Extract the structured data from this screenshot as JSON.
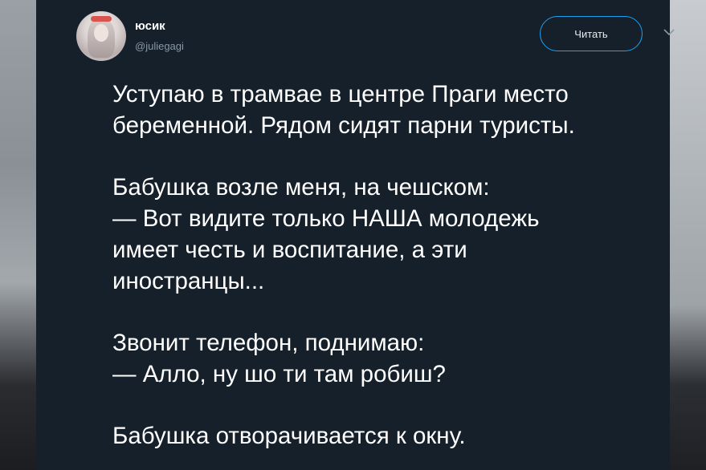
{
  "user": {
    "display_name": "юсик",
    "handle": "@juliegagi",
    "avatar_icon": "profile-photo"
  },
  "follow_button": {
    "label": "Читать"
  },
  "menu_icon": "chevron-down-icon",
  "tweet": {
    "paragraphs": [
      [
        "Уступаю в трамвае в центре Праги место",
        "беременной. Рядом сидят парни туристы."
      ],
      [
        "Бабушка возле меня, на чешском:",
        "— Вот видите только НАША молодежь",
        "имеет честь и воспитание, а эти",
        "иностранцы..."
      ],
      [
        "Звонит телефон, поднимаю:",
        "— Алло, ну шо ти там робиш?"
      ],
      [
        "Бабушка отворачивается к окну."
      ]
    ]
  },
  "colors": {
    "card_background": "#15202b",
    "accent": "#1da1f2",
    "text_primary": "#ffffff",
    "text_secondary": "#8899a6"
  }
}
